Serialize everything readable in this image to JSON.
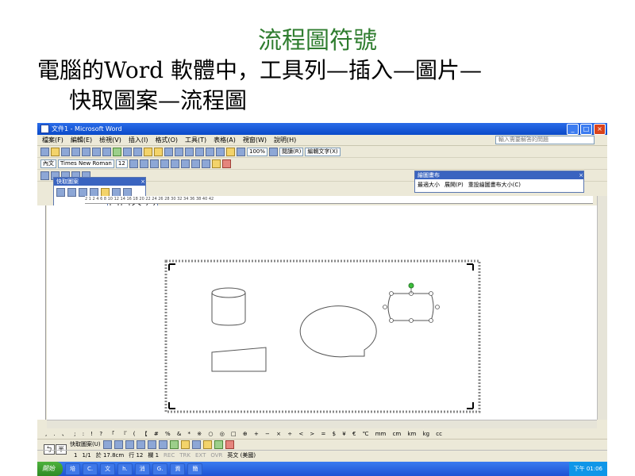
{
  "slide": {
    "title": "流程圖符號",
    "body_line1": "電腦的Word 軟體中，工具列—插入—圖片—",
    "body_line2": "快取圖案—流程圖"
  },
  "window": {
    "title": "文件1 - Microsoft Word",
    "min": "_",
    "max": "□",
    "close": "×"
  },
  "menu": {
    "items": [
      "檔案(F)",
      "編輯(E)",
      "檢視(V)",
      "插入(I)",
      "格式(O)",
      "工具(T)",
      "表格(A)",
      "視窗(W)",
      "說明(H)"
    ],
    "help_placeholder": "輸入需要解答的問題"
  },
  "toolbar": {
    "zoom": "100%",
    "read_label": "閱讀(R)",
    "edit_text": "編輯文字(X)"
  },
  "format_bar": {
    "style": "內文",
    "font": "Times New Roman",
    "size": "12"
  },
  "canvas_toolbar": {
    "title": "繪圖畫布",
    "fit": "最適大小",
    "expand": "展開(P)",
    "scale": "重設繪圖畫布大小(C)"
  },
  "autoshapes": {
    "title": "快取圖案"
  },
  "ruler_text": "2 1 2 4 6 8 10 12 14 16 18 20 22 24 26 28 30 32 34 36 38 40 42",
  "symbol_bar": ", . 、 ; : ! ? 「 『 ( 【 # % & * ※ ○ ◎ □ ⊕ + − × ÷ < > = $ ¥ € ℃ mm cm km kg cc",
  "draw_bar": {
    "autoshapes_label": "快取圖案(U)"
  },
  "status": {
    "page": "頁 1",
    "section": "1",
    "page_of": "1/1",
    "at": "於 17.8cm",
    "line": "行 12",
    "col": "欄 1",
    "rec": "REC",
    "trk": "TRK",
    "ext": "EXT",
    "ovr": "OVR",
    "lang": "英文 (美國)"
  },
  "ime": {
    "a": "ㄅ",
    "b": "半"
  },
  "taskbar": {
    "start": "開始",
    "tasks": [
      "培",
      "C.",
      "文",
      "h.",
      "消",
      "G.",
      "資",
      "簡"
    ],
    "clock": "下午 01:06"
  },
  "accent_colors": {
    "title_green": "#2f7d2f",
    "xp_blue": "#0a4ac9",
    "start_green": "#2f8a24"
  }
}
